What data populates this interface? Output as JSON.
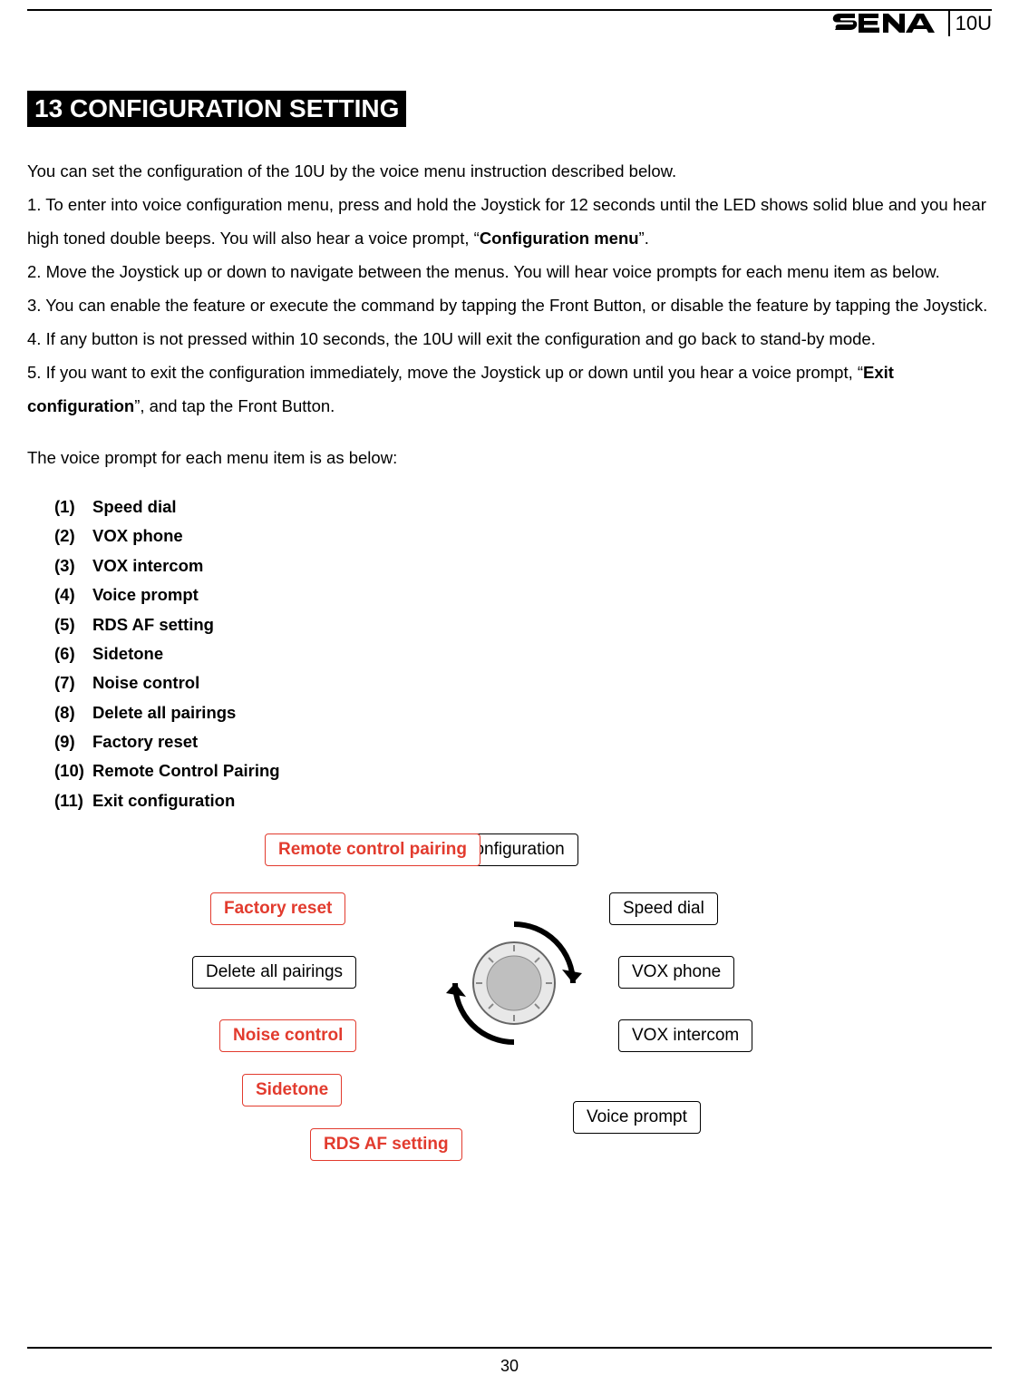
{
  "header": {
    "brand": "SENA",
    "model": "10U"
  },
  "title": "13 CONFIGURATION SETTING",
  "intro_parts": {
    "p0": "You can set the configuration of the 10U by the voice menu instruction described below.",
    "p1a": "1. To enter into voice configuration menu, press and hold the Joystick for 12 seconds until the LED shows solid blue and you hear high toned double beeps. You will also hear a voice prompt, “",
    "p1b": "Configuration menu",
    "p1c": "”.",
    "p2": "2. Move the Joystick up or down to navigate between the menus. You will hear voice prompts for each menu item as below.",
    "p3": "3. You can enable the feature or execute the command by tapping the Front Button, or disable the feature by tapping the Joystick.",
    "p4": "4. If any button is not pressed within 10 seconds, the 10U will exit the configuration and go back to stand-by mode.",
    "p5a": "5. If you want to exit the configuration immediately, move the Joystick up or down until you hear a voice prompt, “",
    "p5b": "Exit configuration",
    "p5c": "”, and tap the Front Button."
  },
  "menu_intro": "The voice prompt for each menu item is as below:",
  "menu_items": [
    "Speed dial",
    "VOX phone",
    "VOX intercom",
    "Voice prompt",
    "RDS AF setting",
    "Sidetone",
    "Noise control",
    "Delete all pairings",
    "Factory reset",
    "Remote Control Pairing",
    "Exit configuration"
  ],
  "diagram": {
    "exit": "Exit configuration",
    "speed": "Speed dial",
    "voxphone": "VOX phone",
    "voxintercom": "VOX intercom",
    "voiceprompt": "Voice prompt",
    "rds": "RDS AF setting",
    "sidetone": "Sidetone",
    "noise": "Noise control",
    "delete": "Delete all pairings",
    "factory": "Factory reset",
    "remote": "Remote control pairing"
  },
  "page_number": "30"
}
